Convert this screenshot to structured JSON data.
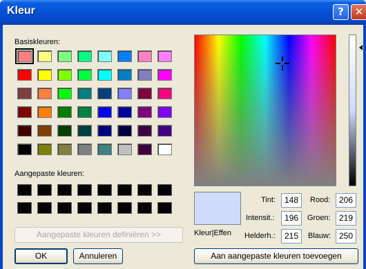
{
  "window": {
    "title": "Kleur",
    "help_glyph": "?",
    "close_glyph": "✕"
  },
  "labels": {
    "basic": "Basiskleuren:",
    "custom": "Aangepaste kleuren:",
    "color_solid": "Kleur|Effen",
    "hue": "Tint:",
    "sat": "Intensit.:",
    "lum": "Helderh.:",
    "red": "Rood:",
    "green": "Groen:",
    "blue": "Blauw:"
  },
  "values": {
    "hue": "148",
    "sat": "196",
    "lum": "215",
    "red": "206",
    "green": "219",
    "blue": "250"
  },
  "buttons": {
    "define_custom": "Aangepaste kleuren definiëren >>",
    "ok": "OK",
    "cancel": "Annuleren",
    "add_custom": "Aan aangepaste kleuren toevoegen"
  },
  "basic_colors": [
    "#ff8080",
    "#ffff80",
    "#80ff80",
    "#00ff80",
    "#80ffff",
    "#0080ff",
    "#ff80c0",
    "#ff80ff",
    "#ff0000",
    "#ffff00",
    "#80ff00",
    "#00ff40",
    "#00ffff",
    "#0080c0",
    "#8080c0",
    "#ff00ff",
    "#804040",
    "#ff8040",
    "#00ff00",
    "#008080",
    "#004080",
    "#8080ff",
    "#800040",
    "#ff0080",
    "#800000",
    "#ff8000",
    "#008000",
    "#008040",
    "#0000ff",
    "#0000a0",
    "#800080",
    "#8000ff",
    "#400000",
    "#804000",
    "#004000",
    "#004040",
    "#000080",
    "#000040",
    "#400040",
    "#400080",
    "#000000",
    "#808000",
    "#808040",
    "#808080",
    "#408080",
    "#c0c0c0",
    "#400040",
    "#ffffff"
  ],
  "selected_color_index": 0,
  "custom_colors": [
    "#000000",
    "#000000",
    "#000000",
    "#000000",
    "#000000",
    "#000000",
    "#000000",
    "#000000",
    "#000000",
    "#000000",
    "#000000",
    "#000000",
    "#000000",
    "#000000",
    "#000000",
    "#000000"
  ],
  "current_color": "#cedbfa"
}
